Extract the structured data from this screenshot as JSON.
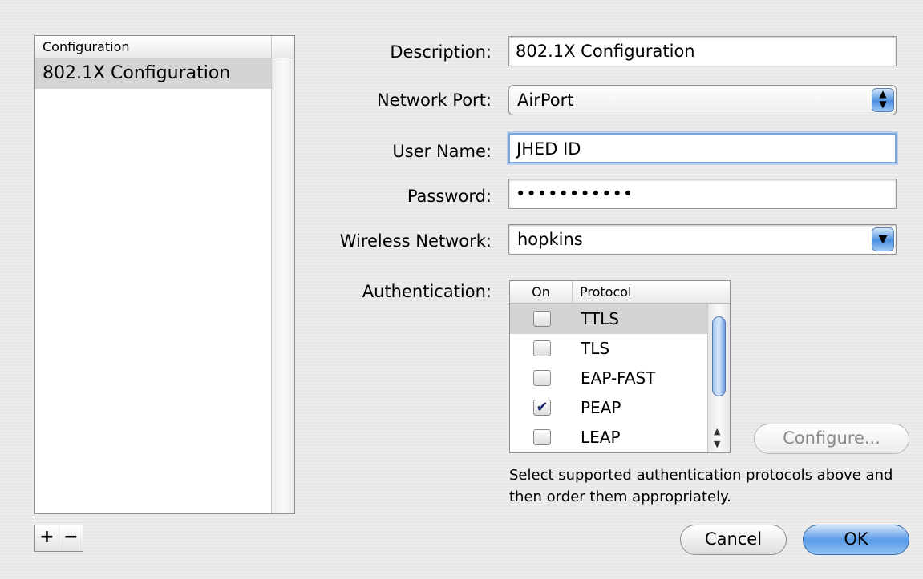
{
  "config_list": {
    "header": "Configuration",
    "items": [
      {
        "label": "802.1X Configuration",
        "selected": true
      }
    ],
    "add_label": "+",
    "remove_label": "−"
  },
  "form": {
    "description_label": "Description:",
    "description_value": "802.1X Configuration",
    "network_port_label": "Network Port:",
    "network_port_value": "AirPort",
    "username_label": "User Name:",
    "username_value": "JHED ID",
    "password_label": "Password:",
    "password_value": "•••••••••••",
    "wireless_label": "Wireless Network:",
    "wireless_value": "hopkins",
    "auth_label": "Authentication:"
  },
  "auth_table": {
    "col_on": "On",
    "col_protocol": "Protocol",
    "rows": [
      {
        "protocol": "TTLS",
        "checked": false,
        "selected": true
      },
      {
        "protocol": "TLS",
        "checked": false,
        "selected": false
      },
      {
        "protocol": "EAP-FAST",
        "checked": false,
        "selected": false
      },
      {
        "protocol": "PEAP",
        "checked": true,
        "selected": false
      },
      {
        "protocol": "LEAP",
        "checked": false,
        "selected": false
      }
    ]
  },
  "buttons": {
    "configure": "Configure...",
    "cancel": "Cancel",
    "ok": "OK"
  },
  "hint": "Select supported authentication protocols above and then order them appropriately.",
  "icons": {
    "popup_arrows": "up-down-chevron-icon",
    "combo_arrow": "chevron-down-icon",
    "check": "checkmark-icon"
  },
  "colors": {
    "accent": "#4b8fe0",
    "focus_ring": "#7aa5d8",
    "selection": "#d4d4d4"
  }
}
